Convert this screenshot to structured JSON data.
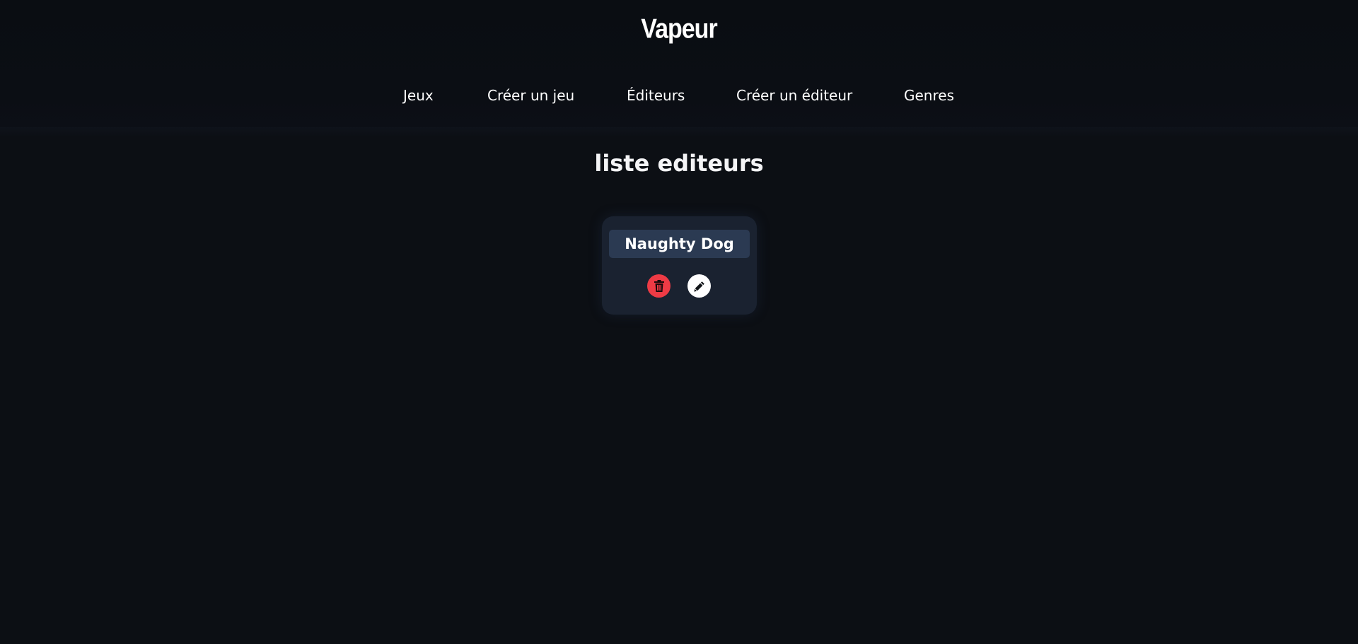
{
  "app": {
    "logo": "Vapeur"
  },
  "nav": {
    "items": [
      {
        "label": "Jeux"
      },
      {
        "label": "Créer un jeu"
      },
      {
        "label": "Éditeurs"
      },
      {
        "label": "Créer un éditeur"
      },
      {
        "label": "Genres"
      }
    ]
  },
  "main": {
    "title": "liste editeurs",
    "editors": [
      {
        "name": "Naughty Dog",
        "delete_icon": "trash-icon",
        "edit_icon": "pencil-icon"
      }
    ]
  },
  "colors": {
    "background": "#0c0f14",
    "card": "#1a2230",
    "card_name_bg": "#2b3a52",
    "delete": "#ee3b45",
    "edit": "#ffffff"
  }
}
